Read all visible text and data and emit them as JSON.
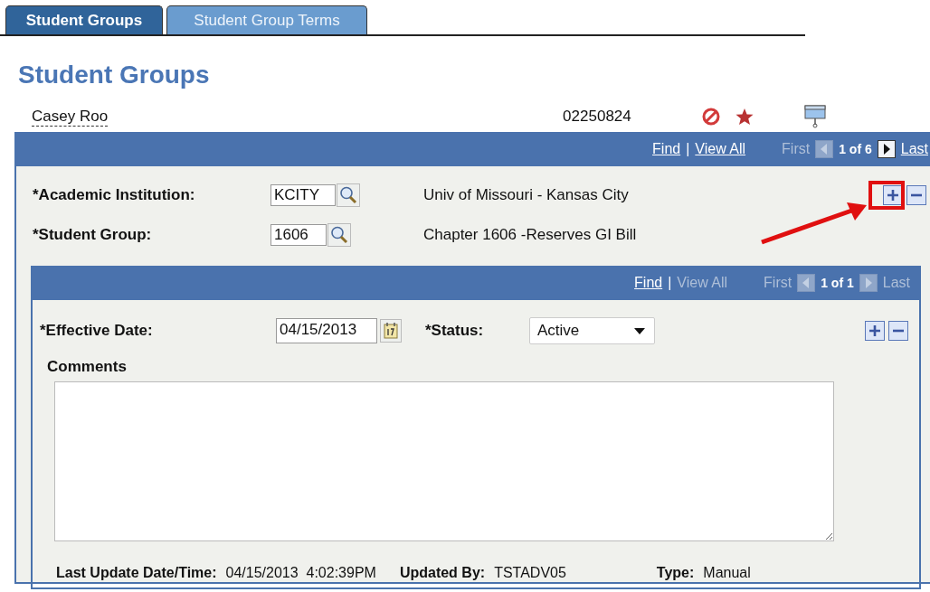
{
  "tabs": [
    {
      "label": "Student Groups",
      "selected": true
    },
    {
      "label": "Student Group Terms",
      "selected": false
    }
  ],
  "page_title": "Student Groups",
  "student": {
    "name": "Casey Roo",
    "id": "02250824"
  },
  "outer_nav": {
    "find": {
      "label": "Find",
      "disabled": false
    },
    "separator": "|",
    "view_all": {
      "label": "View All",
      "disabled": false
    },
    "first": {
      "label": "First",
      "disabled": true
    },
    "previous": {
      "disabled": true
    },
    "count": "1 of 6",
    "next": {
      "disabled": false
    },
    "last": {
      "label": "Last",
      "disabled": false
    }
  },
  "fields": [
    {
      "label": "*Academic Institution:",
      "value": "KCITY",
      "description": "Univ of Missouri - Kansas City"
    },
    {
      "label": "*Student Group:",
      "value": "1606",
      "description": "Chapter 1606 -Reserves GI Bill"
    }
  ],
  "inner_nav": {
    "find": {
      "label": "Find",
      "disabled": false
    },
    "separator": "|",
    "view_all": {
      "label": "View All",
      "disabled": true
    },
    "first": {
      "label": "First",
      "disabled": true
    },
    "previous": {
      "disabled": true
    },
    "count": "1 of 1",
    "next": {
      "disabled": true
    },
    "last": {
      "label": "Last",
      "disabled": true
    }
  },
  "effective_date": {
    "label": "*Effective Date:",
    "value": "04/15/2013"
  },
  "status": {
    "label": "*Status:",
    "value": "Active"
  },
  "comments": {
    "label": "Comments"
  },
  "footer": [
    {
      "label": "Last Update Date/Time:",
      "value": "04/15/2013  4:02:39PM"
    },
    {
      "label": "Updated By:",
      "value": "TSTADV05"
    },
    {
      "label": "Type:",
      "value": "Manual"
    }
  ]
}
